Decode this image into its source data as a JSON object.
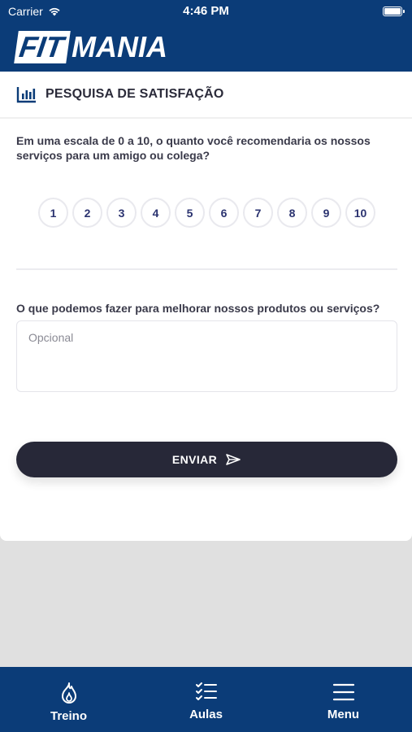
{
  "status_bar": {
    "carrier": "Carrier",
    "time": "4:46 PM"
  },
  "logo": {
    "boxed": "FIT",
    "rest": "MANIA"
  },
  "card": {
    "title": "PESQUISA DE SATISFAÇÃO",
    "question": "Em uma escala de 0 a 10, o quanto você recomendaria os nossos serviços para um amigo ou colega?",
    "scale": [
      "1",
      "2",
      "3",
      "4",
      "5",
      "6",
      "7",
      "8",
      "9",
      "10"
    ],
    "improve_label": "O que podemos fazer para melhorar nossos produtos ou serviços?",
    "textarea_placeholder": "Opcional",
    "submit_label": "ENVIAR"
  },
  "tabs": [
    {
      "label": "Treino",
      "icon": "flame-icon"
    },
    {
      "label": "Aulas",
      "icon": "checklist-icon"
    },
    {
      "label": "Menu",
      "icon": "hamburger-icon"
    }
  ],
  "colors": {
    "brand": "#0b3c78",
    "button": "#272838",
    "scale_text": "#2b3370"
  }
}
